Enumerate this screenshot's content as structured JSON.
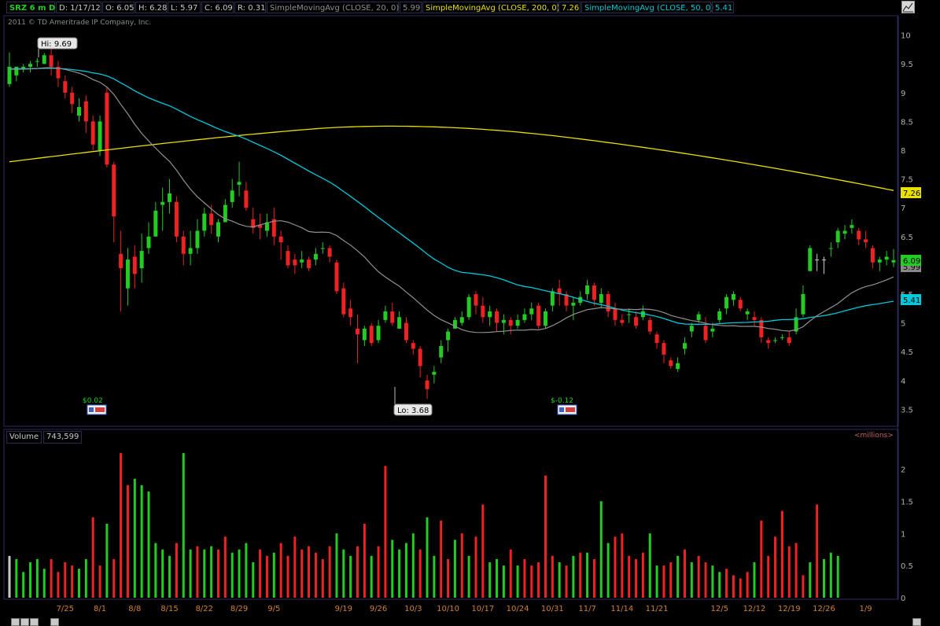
{
  "header": {
    "symbol": "SRZ 6 m D",
    "date": "D: 1/17/12",
    "open": "O: 6.05",
    "high": "H: 6.28",
    "low": "L: 5.97",
    "close": "C: 6.09",
    "range": "R: 0.31",
    "sma20_label": "SimpleMovingAvg (CLOSE, 20, 0)",
    "sma20_value": "5.99",
    "sma200_label": "SimpleMovingAvg (CLOSE, 200, 0)",
    "sma200_value": "7.26",
    "sma50_label": "SimpleMovingAvg (CLOSE, 50, 0)",
    "sma50_value": "5.41"
  },
  "copyright": "2011 © TD Ameritrade IP Company, Inc.",
  "annotations": {
    "hi_label": "Hi: 9.69",
    "lo_label": "Lo: 3.68",
    "dividend1": "$0.02",
    "dividend2": "$-0.12",
    "price_tag_close": "6.09",
    "price_tag_sma200": "7.26",
    "price_tag_sma50": "5.41",
    "price_tag_sma20": "5.99"
  },
  "volume_panel": {
    "label": "Volume",
    "value": "743,599",
    "units": "<millions>"
  },
  "colors": {
    "up": "#22cc22",
    "down": "#ee2222",
    "sma200": "#e8e000",
    "sma50": "#00c8d8",
    "sma20": "#909090",
    "axis_text": "#b0b0b0",
    "date_text": "#d08030",
    "border": "#2a2a5a",
    "gray_candle": "#c8c8c8"
  },
  "chart_data": {
    "type": "candlestick",
    "price_ticks": [
      "3.5",
      "4",
      "4.5",
      "5",
      "5.5",
      "6",
      "6.5",
      "7",
      "7.5",
      "8",
      "8.5",
      "9",
      "9.5",
      "10"
    ],
    "price_ylim": [
      3.3,
      10.2
    ],
    "volume_ticks": [
      "0",
      "0.5",
      "1",
      "1.5",
      "2"
    ],
    "volume_ylim": [
      0,
      2.3
    ],
    "x_labels": [
      {
        "i": 8,
        "label": "7/25"
      },
      {
        "i": 13,
        "label": "8/1"
      },
      {
        "i": 18,
        "label": "8/8"
      },
      {
        "i": 23,
        "label": "8/15"
      },
      {
        "i": 28,
        "label": "8/22"
      },
      {
        "i": 33,
        "label": "8/29"
      },
      {
        "i": 38,
        "label": "9/5"
      },
      {
        "i": 48,
        "label": "9/19"
      },
      {
        "i": 53,
        "label": "9/26"
      },
      {
        "i": 58,
        "label": "10/3"
      },
      {
        "i": 63,
        "label": "10/10"
      },
      {
        "i": 68,
        "label": "10/17"
      },
      {
        "i": 73,
        "label": "10/24"
      },
      {
        "i": 78,
        "label": "10/31"
      },
      {
        "i": 83,
        "label": "11/7"
      },
      {
        "i": 88,
        "label": "11/14"
      },
      {
        "i": 93,
        "label": "11/21"
      },
      {
        "i": 102,
        "label": "12/5"
      },
      {
        "i": 107,
        "label": "12/12"
      },
      {
        "i": 112,
        "label": "12/19"
      },
      {
        "i": 117,
        "label": "12/26"
      },
      {
        "i": 123,
        "label": "1/9"
      }
    ],
    "candles": [
      [
        9.45,
        9.7,
        9.15,
        9.1,
        "g"
      ],
      [
        9.3,
        9.45,
        9.45,
        9.2,
        "g"
      ],
      [
        9.4,
        9.5,
        9.45,
        9.35,
        "g"
      ],
      [
        9.45,
        9.55,
        9.5,
        9.35,
        "g"
      ],
      [
        9.55,
        9.6,
        9.55,
        9.45,
        "g"
      ],
      [
        9.5,
        9.69,
        9.65,
        9.5,
        "g"
      ],
      [
        9.65,
        9.8,
        9.45,
        9.3,
        "r"
      ],
      [
        9.45,
        9.55,
        9.25,
        9.1,
        "r"
      ],
      [
        9.2,
        9.3,
        9.0,
        8.9,
        "r"
      ],
      [
        9.0,
        9.1,
        8.8,
        8.65,
        "r"
      ],
      [
        8.6,
        8.9,
        8.75,
        8.5,
        "g"
      ],
      [
        8.85,
        8.95,
        8.5,
        8.3,
        "r"
      ],
      [
        8.5,
        8.6,
        8.1,
        8.0,
        "r"
      ],
      [
        8.0,
        8.6,
        8.5,
        7.9,
        "g"
      ],
      [
        9.0,
        9.1,
        7.75,
        7.7,
        "r"
      ],
      [
        7.75,
        7.8,
        6.85,
        6.4,
        "r"
      ],
      [
        6.2,
        6.6,
        5.95,
        5.2,
        "r"
      ],
      [
        5.6,
        6.3,
        6.1,
        5.3,
        "g"
      ],
      [
        6.15,
        6.35,
        5.85,
        5.6,
        "r"
      ],
      [
        5.95,
        6.55,
        6.25,
        5.7,
        "g"
      ],
      [
        6.3,
        6.75,
        6.5,
        6.2,
        "g"
      ],
      [
        6.5,
        7.1,
        6.95,
        6.5,
        "g"
      ],
      [
        7.05,
        7.35,
        7.1,
        6.6,
        "g"
      ],
      [
        7.1,
        7.5,
        7.25,
        6.9,
        "g"
      ],
      [
        7.1,
        7.2,
        6.5,
        6.4,
        "r"
      ],
      [
        6.5,
        6.6,
        6.2,
        6.0,
        "r"
      ],
      [
        6.2,
        6.6,
        6.3,
        6.0,
        "g"
      ],
      [
        6.3,
        6.8,
        6.6,
        6.2,
        "g"
      ],
      [
        6.6,
        7.0,
        6.9,
        6.5,
        "g"
      ],
      [
        6.9,
        7.05,
        6.7,
        6.55,
        "r"
      ],
      [
        6.5,
        6.8,
        6.75,
        6.4,
        "g"
      ],
      [
        6.75,
        7.15,
        7.05,
        6.75,
        "g"
      ],
      [
        7.1,
        7.5,
        7.3,
        7.0,
        "g"
      ],
      [
        7.4,
        7.8,
        7.45,
        7.2,
        "g"
      ],
      [
        7.3,
        7.45,
        7.0,
        6.95,
        "r"
      ],
      [
        6.8,
        7.0,
        6.65,
        6.55,
        "r"
      ],
      [
        6.7,
        6.9,
        6.65,
        6.45,
        "r"
      ],
      [
        6.6,
        6.9,
        6.75,
        6.5,
        "g"
      ],
      [
        6.8,
        7.0,
        6.5,
        6.35,
        "r"
      ],
      [
        6.5,
        6.6,
        6.4,
        6.1,
        "r"
      ],
      [
        6.25,
        6.35,
        6.0,
        5.95,
        "r"
      ],
      [
        6.1,
        6.2,
        6.0,
        5.85,
        "r"
      ],
      [
        6.05,
        6.25,
        6.1,
        5.95,
        "g"
      ],
      [
        6.1,
        6.15,
        5.95,
        5.9,
        "r"
      ],
      [
        6.1,
        6.3,
        6.2,
        6.0,
        "g"
      ],
      [
        6.3,
        6.4,
        6.3,
        6.2,
        "g"
      ],
      [
        6.3,
        6.35,
        6.15,
        6.05,
        "r"
      ],
      [
        6.05,
        6.1,
        5.55,
        5.5,
        "r"
      ],
      [
        5.6,
        5.7,
        5.15,
        5.1,
        "r"
      ],
      [
        5.25,
        5.4,
        5.1,
        4.95,
        "r"
      ],
      [
        4.9,
        5.15,
        4.8,
        4.3,
        "r"
      ],
      [
        4.7,
        4.95,
        4.9,
        4.6,
        "g"
      ],
      [
        4.95,
        5.0,
        4.65,
        4.6,
        "r"
      ],
      [
        4.7,
        5.05,
        4.95,
        4.65,
        "g"
      ],
      [
        5.05,
        5.3,
        5.2,
        5.0,
        "g"
      ],
      [
        5.2,
        5.35,
        5.0,
        4.95,
        "r"
      ],
      [
        4.9,
        5.2,
        5.1,
        4.9,
        "g"
      ],
      [
        5.0,
        5.1,
        4.7,
        4.65,
        "r"
      ],
      [
        4.65,
        4.7,
        4.55,
        4.45,
        "r"
      ],
      [
        4.55,
        4.6,
        4.25,
        4.05,
        "r"
      ],
      [
        4.0,
        4.1,
        3.85,
        3.68,
        "r"
      ],
      [
        4.1,
        4.25,
        4.15,
        3.95,
        "g"
      ],
      [
        4.4,
        4.7,
        4.6,
        4.3,
        "g"
      ],
      [
        4.7,
        4.9,
        4.85,
        4.5,
        "g"
      ],
      [
        4.9,
        5.1,
        5.05,
        4.9,
        "g"
      ],
      [
        5.0,
        5.2,
        5.1,
        4.95,
        "g"
      ],
      [
        5.1,
        5.5,
        5.45,
        5.05,
        "g"
      ],
      [
        5.5,
        5.55,
        5.3,
        5.15,
        "r"
      ],
      [
        5.3,
        5.45,
        5.1,
        5.0,
        "r"
      ],
      [
        5.1,
        5.3,
        5.2,
        4.95,
        "g"
      ],
      [
        5.2,
        5.25,
        5.0,
        4.85,
        "r"
      ],
      [
        5.0,
        5.15,
        5.05,
        4.8,
        "g"
      ],
      [
        5.05,
        5.1,
        4.95,
        4.8,
        "r"
      ],
      [
        4.95,
        5.15,
        5.05,
        4.9,
        "g"
      ],
      [
        5.05,
        5.25,
        5.15,
        5.0,
        "g"
      ],
      [
        5.15,
        5.35,
        5.25,
        5.05,
        "g"
      ],
      [
        5.3,
        5.35,
        4.95,
        4.9,
        "r"
      ],
      [
        4.95,
        5.25,
        5.2,
        4.9,
        "g"
      ],
      [
        5.3,
        5.6,
        5.55,
        5.2,
        "g"
      ],
      [
        5.6,
        5.75,
        5.5,
        5.3,
        "r"
      ],
      [
        5.5,
        5.55,
        5.3,
        5.2,
        "r"
      ],
      [
        5.3,
        5.45,
        5.35,
        5.05,
        "g"
      ],
      [
        5.35,
        5.55,
        5.45,
        5.3,
        "g"
      ],
      [
        5.5,
        5.75,
        5.65,
        5.4,
        "g"
      ],
      [
        5.65,
        5.7,
        5.4,
        5.3,
        "r"
      ],
      [
        5.35,
        5.6,
        5.5,
        5.25,
        "g"
      ],
      [
        5.5,
        5.55,
        5.2,
        5.1,
        "r"
      ],
      [
        5.25,
        5.35,
        5.05,
        4.95,
        "r"
      ],
      [
        5.05,
        5.15,
        5.0,
        4.95,
        "r"
      ],
      [
        5.15,
        5.25,
        5.15,
        5.0,
        "g"
      ],
      [
        5.1,
        5.2,
        4.95,
        4.9,
        "r"
      ],
      [
        5.1,
        5.3,
        5.2,
        5.05,
        "g"
      ],
      [
        5.05,
        5.1,
        4.85,
        4.8,
        "r"
      ],
      [
        4.8,
        4.85,
        4.65,
        4.55,
        "r"
      ],
      [
        4.65,
        4.7,
        4.45,
        4.3,
        "r"
      ],
      [
        4.35,
        4.4,
        4.25,
        4.2,
        "r"
      ],
      [
        4.2,
        4.4,
        4.3,
        4.15,
        "g"
      ],
      [
        4.55,
        4.75,
        4.65,
        4.45,
        "g"
      ],
      [
        4.85,
        5.0,
        4.95,
        4.75,
        "g"
      ],
      [
        5.05,
        5.2,
        5.15,
        5.0,
        "g"
      ],
      [
        4.95,
        5.1,
        4.7,
        4.65,
        "r"
      ],
      [
        4.85,
        5.0,
        4.9,
        4.75,
        "g"
      ],
      [
        5.05,
        5.25,
        5.2,
        5.0,
        "g"
      ],
      [
        5.25,
        5.5,
        5.45,
        5.15,
        "g"
      ],
      [
        5.4,
        5.55,
        5.5,
        5.3,
        "g"
      ],
      [
        5.4,
        5.45,
        5.25,
        5.2,
        "r"
      ],
      [
        5.15,
        5.25,
        5.2,
        5.05,
        "g"
      ],
      [
        5.1,
        5.2,
        5.05,
        4.95,
        "r"
      ],
      [
        5.05,
        5.1,
        4.75,
        4.65,
        "r"
      ],
      [
        4.7,
        4.75,
        4.65,
        4.55,
        "r"
      ],
      [
        4.7,
        4.75,
        4.7,
        4.65,
        "g"
      ],
      [
        4.75,
        4.8,
        4.75,
        4.7,
        "g"
      ],
      [
        4.75,
        4.85,
        4.65,
        4.6,
        "r"
      ],
      [
        4.85,
        5.25,
        5.1,
        4.8,
        "g"
      ],
      [
        5.15,
        5.65,
        5.5,
        5.1,
        "g"
      ],
      [
        5.9,
        6.35,
        6.3,
        5.9,
        "g"
      ],
      [
        6.1,
        6.2,
        6.1,
        5.9,
        "gr"
      ],
      [
        6.1,
        6.15,
        6.1,
        5.85,
        "gr"
      ],
      [
        6.3,
        6.4,
        6.3,
        6.15,
        "g"
      ],
      [
        6.4,
        6.65,
        6.6,
        6.3,
        "g"
      ],
      [
        6.55,
        6.7,
        6.6,
        6.45,
        "g"
      ],
      [
        6.65,
        6.8,
        6.7,
        6.55,
        "g"
      ],
      [
        6.6,
        6.65,
        6.45,
        6.35,
        "r"
      ],
      [
        6.45,
        6.6,
        6.4,
        6.3,
        "r"
      ],
      [
        6.3,
        6.35,
        6.05,
        5.95,
        "r"
      ],
      [
        6.05,
        6.15,
        6.1,
        5.9,
        "g"
      ],
      [
        6.15,
        6.25,
        6.1,
        6.0,
        "g"
      ],
      [
        6.05,
        6.28,
        6.09,
        5.97,
        "g"
      ]
    ],
    "volume": [
      [
        0.65,
        "gr"
      ],
      [
        0.6,
        "g"
      ],
      [
        0.4,
        "g"
      ],
      [
        0.55,
        "g"
      ],
      [
        0.6,
        "g"
      ],
      [
        0.45,
        "g"
      ],
      [
        0.6,
        "r"
      ],
      [
        0.4,
        "r"
      ],
      [
        0.55,
        "r"
      ],
      [
        0.5,
        "r"
      ],
      [
        0.45,
        "g"
      ],
      [
        0.6,
        "g"
      ],
      [
        1.25,
        "r"
      ],
      [
        0.5,
        "r"
      ],
      [
        1.15,
        "g"
      ],
      [
        0.6,
        "r"
      ],
      [
        2.25,
        "r"
      ],
      [
        1.75,
        "r"
      ],
      [
        1.85,
        "g"
      ],
      [
        1.75,
        "g"
      ],
      [
        1.65,
        "g"
      ],
      [
        0.85,
        "g"
      ],
      [
        0.75,
        "g"
      ],
      [
        0.65,
        "g"
      ],
      [
        0.85,
        "r"
      ],
      [
        2.25,
        "g"
      ],
      [
        0.75,
        "g"
      ],
      [
        0.8,
        "r"
      ],
      [
        0.75,
        "g"
      ],
      [
        0.8,
        "g"
      ],
      [
        0.75,
        "r"
      ],
      [
        0.95,
        "r"
      ],
      [
        0.7,
        "g"
      ],
      [
        0.75,
        "g"
      ],
      [
        0.85,
        "g"
      ],
      [
        0.55,
        "g"
      ],
      [
        0.75,
        "r"
      ],
      [
        0.65,
        "r"
      ],
      [
        0.7,
        "g"
      ],
      [
        0.85,
        "r"
      ],
      [
        0.65,
        "r"
      ],
      [
        0.95,
        "r"
      ],
      [
        0.75,
        "r"
      ],
      [
        0.8,
        "r"
      ],
      [
        0.7,
        "r"
      ],
      [
        0.6,
        "r"
      ],
      [
        0.8,
        "r"
      ],
      [
        1.0,
        "g"
      ],
      [
        0.75,
        "g"
      ],
      [
        0.65,
        "g"
      ],
      [
        0.8,
        "r"
      ],
      [
        1.15,
        "r"
      ],
      [
        0.65,
        "g"
      ],
      [
        0.8,
        "r"
      ],
      [
        2.05,
        "r"
      ],
      [
        0.9,
        "g"
      ],
      [
        0.75,
        "g"
      ],
      [
        0.85,
        "g"
      ],
      [
        1.0,
        "g"
      ],
      [
        0.75,
        "r"
      ],
      [
        1.25,
        "g"
      ],
      [
        0.65,
        "g"
      ],
      [
        1.2,
        "r"
      ],
      [
        0.6,
        "r"
      ],
      [
        0.9,
        "g"
      ],
      [
        1.0,
        "r"
      ],
      [
        0.65,
        "g"
      ],
      [
        0.95,
        "r"
      ],
      [
        1.45,
        "r"
      ],
      [
        0.55,
        "g"
      ],
      [
        0.6,
        "g"
      ],
      [
        0.5,
        "g"
      ],
      [
        0.75,
        "r"
      ],
      [
        0.5,
        "g"
      ],
      [
        0.6,
        "r"
      ],
      [
        0.5,
        "r"
      ],
      [
        0.55,
        "r"
      ],
      [
        1.9,
        "r"
      ],
      [
        0.65,
        "r"
      ],
      [
        0.55,
        "g"
      ],
      [
        0.5,
        "r"
      ],
      [
        0.65,
        "g"
      ],
      [
        0.7,
        "r"
      ],
      [
        0.7,
        "g"
      ],
      [
        0.6,
        "r"
      ],
      [
        1.5,
        "g"
      ],
      [
        0.85,
        "g"
      ],
      [
        0.95,
        "r"
      ],
      [
        1.0,
        "r"
      ],
      [
        0.65,
        "r"
      ],
      [
        0.6,
        "r"
      ],
      [
        0.7,
        "r"
      ],
      [
        1.0,
        "g"
      ],
      [
        0.5,
        "g"
      ],
      [
        0.5,
        "r"
      ],
      [
        0.55,
        "r"
      ],
      [
        0.65,
        "g"
      ],
      [
        0.75,
        "r"
      ],
      [
        0.55,
        "g"
      ],
      [
        0.65,
        "r"
      ],
      [
        0.55,
        "r"
      ],
      [
        0.5,
        "g"
      ],
      [
        0.4,
        "g"
      ],
      [
        0.45,
        "r"
      ],
      [
        0.35,
        "r"
      ],
      [
        0.3,
        "r"
      ],
      [
        0.4,
        "r"
      ],
      [
        0.55,
        "g"
      ],
      [
        1.2,
        "r"
      ],
      [
        0.65,
        "r"
      ],
      [
        0.95,
        "r"
      ],
      [
        1.35,
        "r"
      ],
      [
        0.8,
        "r"
      ],
      [
        0.85,
        "r"
      ],
      [
        0.35,
        "r"
      ],
      [
        0.55,
        "g"
      ],
      [
        1.45,
        "r"
      ],
      [
        0.6,
        "g"
      ],
      [
        0.7,
        "g"
      ],
      [
        0.65,
        "g"
      ]
    ]
  }
}
